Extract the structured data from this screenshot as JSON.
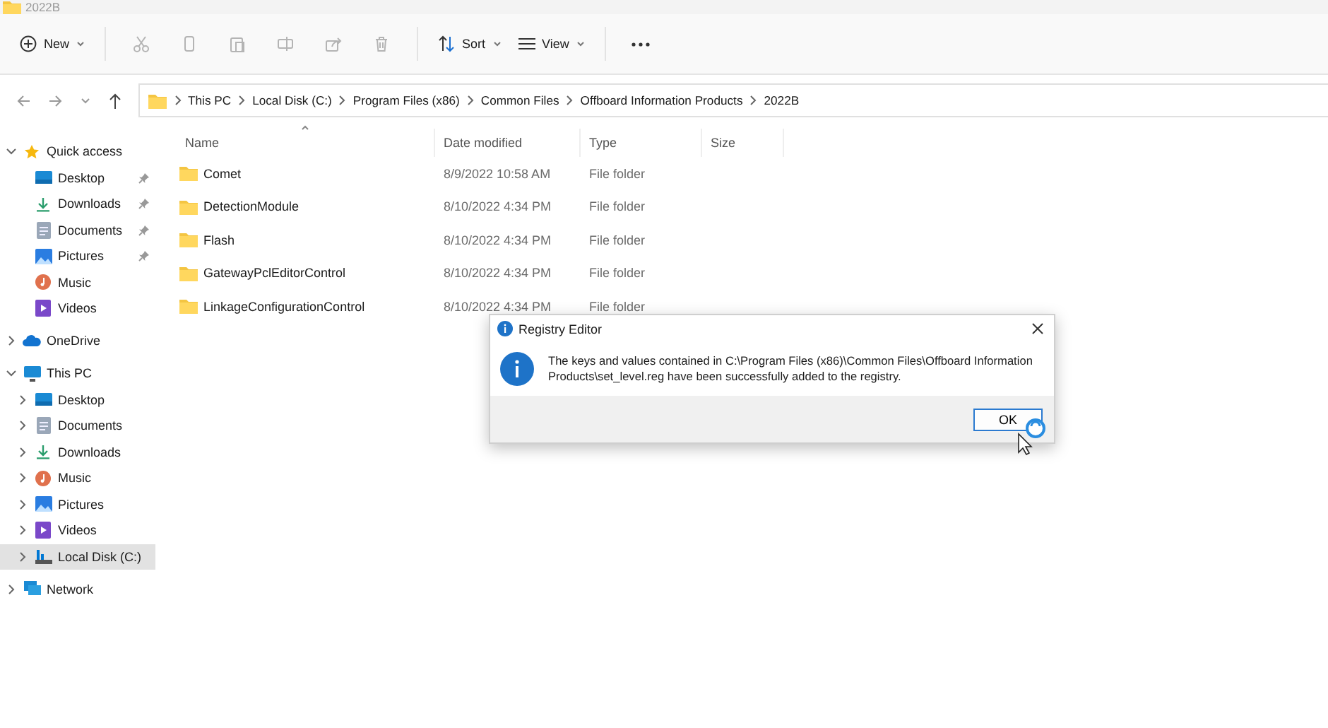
{
  "window": {
    "title": "2022B"
  },
  "toolbar": [
    {
      "kind": "new",
      "label": "New",
      "dropdown": true,
      "disabled": false
    },
    {
      "kind": "cut",
      "disabled": true
    },
    {
      "kind": "copy",
      "disabled": true
    },
    {
      "kind": "paste",
      "disabled": true
    },
    {
      "kind": "rename",
      "disabled": true
    },
    {
      "kind": "share",
      "disabled": true
    },
    {
      "kind": "delete",
      "disabled": true
    },
    {
      "kind": "sort",
      "label": "Sort",
      "dropdown": true,
      "disabled": false
    },
    {
      "kind": "view",
      "label": "View",
      "dropdown": true,
      "disabled": false
    },
    {
      "kind": "more",
      "disabled": false
    }
  ],
  "address_bar": {
    "segments": [
      "This PC",
      "Local Disk (C:)",
      "Program Files (x86)",
      "Common Files",
      "Offboard Information Products",
      "2022B"
    ]
  },
  "sidebar": {
    "items": [
      {
        "label": "Quick access",
        "kind": "star",
        "expanded": true,
        "selected": false,
        "children": [
          {
            "label": "Desktop",
            "kind": "desktop",
            "pinned": true,
            "selected": false
          },
          {
            "label": "Downloads",
            "kind": "download",
            "pinned": true,
            "selected": false
          },
          {
            "label": "Documents",
            "kind": "document",
            "pinned": true,
            "selected": false
          },
          {
            "label": "Pictures",
            "kind": "picture",
            "pinned": true,
            "selected": false
          },
          {
            "label": "Music",
            "kind": "music",
            "pinned": false,
            "selected": false
          },
          {
            "label": "Videos",
            "kind": "video",
            "pinned": false,
            "selected": false
          }
        ]
      },
      {
        "label": "OneDrive",
        "kind": "cloud",
        "expanded": false,
        "selected": false
      },
      {
        "label": "This PC",
        "kind": "pc",
        "expanded": true,
        "selected": false,
        "children": [
          {
            "label": "Desktop",
            "kind": "desktop",
            "expanded": false,
            "selected": false
          },
          {
            "label": "Documents",
            "kind": "document",
            "expanded": false,
            "selected": false
          },
          {
            "label": "Downloads",
            "kind": "download",
            "expanded": false,
            "selected": false
          },
          {
            "label": "Music",
            "kind": "music",
            "expanded": false,
            "selected": false
          },
          {
            "label": "Pictures",
            "kind": "picture",
            "expanded": false,
            "selected": false
          },
          {
            "label": "Videos",
            "kind": "video",
            "expanded": false,
            "selected": false
          },
          {
            "label": "Local Disk (C:)",
            "kind": "drive",
            "expanded": false,
            "selected": true
          }
        ]
      },
      {
        "label": "Network",
        "kind": "network",
        "expanded": false,
        "selected": false
      }
    ]
  },
  "file_list": {
    "columns": [
      {
        "label": "Name",
        "sorted": true
      },
      {
        "label": "Date modified",
        "sorted": false
      },
      {
        "label": "Type",
        "sorted": false
      },
      {
        "label": "Size",
        "sorted": false
      }
    ],
    "rows": [
      {
        "name": "Comet",
        "date_modified": "8/9/2022 10:58 AM",
        "type": "File folder"
      },
      {
        "name": "DetectionModule",
        "date_modified": "8/10/2022 4:34 PM",
        "type": "File folder"
      },
      {
        "name": "Flash",
        "date_modified": "8/10/2022 4:34 PM",
        "type": "File folder"
      },
      {
        "name": "GatewayPclEditorControl",
        "date_modified": "8/10/2022 4:34 PM",
        "type": "File folder"
      },
      {
        "name": "LinkageConfigurationControl",
        "date_modified": "8/10/2022 4:34 PM",
        "type": "File folder"
      }
    ]
  },
  "dialog": {
    "title": "Registry Editor",
    "message": "The keys and values contained in C:\\Program Files (x86)\\Common Files\\Offboard Information Products\\set_level.reg have been successfully added to the registry.",
    "buttons": [
      {
        "label": "OK",
        "focused": true
      }
    ]
  }
}
